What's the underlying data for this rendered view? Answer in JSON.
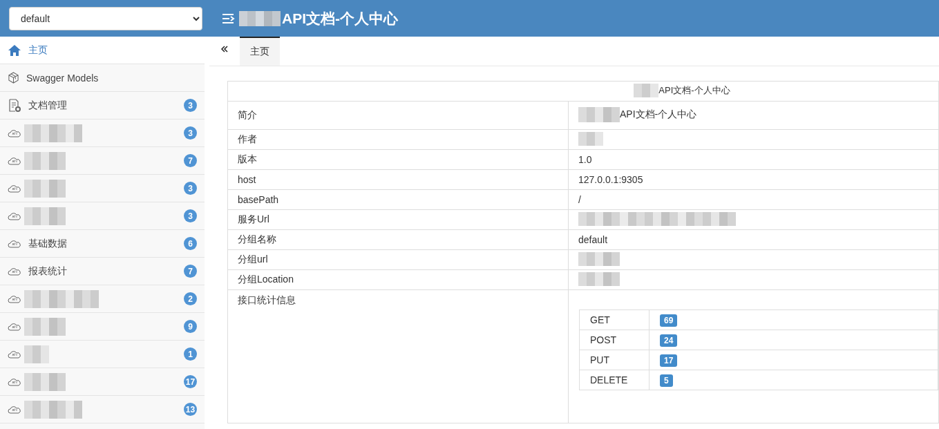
{
  "header": {
    "group_select": {
      "value": "default"
    },
    "title": {
      "redacted_prefix": true,
      "text": "API文档-个人中心"
    }
  },
  "sidebar": {
    "items": [
      {
        "kind": "home",
        "label": "主页",
        "selected": true
      },
      {
        "kind": "models",
        "label": "Swagger Models",
        "selected": false
      },
      {
        "kind": "docs",
        "label": "文档管理",
        "count": "3",
        "selected": false
      },
      {
        "kind": "group",
        "count": "3",
        "selected": false
      },
      {
        "kind": "group",
        "count": "7",
        "selected": false
      },
      {
        "kind": "group",
        "count": "3",
        "selected": false
      },
      {
        "kind": "group",
        "count": "3",
        "selected": false
      },
      {
        "kind": "group",
        "label": "基础数据",
        "count": "6",
        "selected": false
      },
      {
        "kind": "group",
        "label": "报表统计",
        "count": "7",
        "selected": false
      },
      {
        "kind": "group",
        "count": "2",
        "selected": false
      },
      {
        "kind": "group",
        "count": "9",
        "selected": false
      },
      {
        "kind": "group",
        "count": "1",
        "selected": false
      },
      {
        "kind": "group",
        "count": "17",
        "selected": false
      },
      {
        "kind": "group",
        "count": "13",
        "selected": false
      }
    ]
  },
  "tabs": [
    {
      "label": "主页",
      "selected": true
    }
  ],
  "info_table": {
    "title": {
      "redacted_prefix": true,
      "text": "API文档-个人中心"
    },
    "rows": [
      {
        "label": "简介",
        "redacted_prefix": true,
        "value": "API文档-个人中心"
      },
      {
        "label": "作者"
      },
      {
        "label": "版本",
        "value": "1.0"
      },
      {
        "label": "host",
        "value": "127.0.0.1:9305"
      },
      {
        "label": "basePath",
        "value": "/"
      },
      {
        "label": "服务Url"
      },
      {
        "label": "分组名称",
        "value": "default"
      },
      {
        "label": "分组url"
      },
      {
        "label": "分组Location"
      },
      {
        "label": "接口统计信息",
        "stats": [
          {
            "method": "GET",
            "count": "69"
          },
          {
            "method": "POST",
            "count": "24"
          },
          {
            "method": "PUT",
            "count": "17"
          },
          {
            "method": "DELETE",
            "count": "5"
          }
        ]
      }
    ]
  }
}
